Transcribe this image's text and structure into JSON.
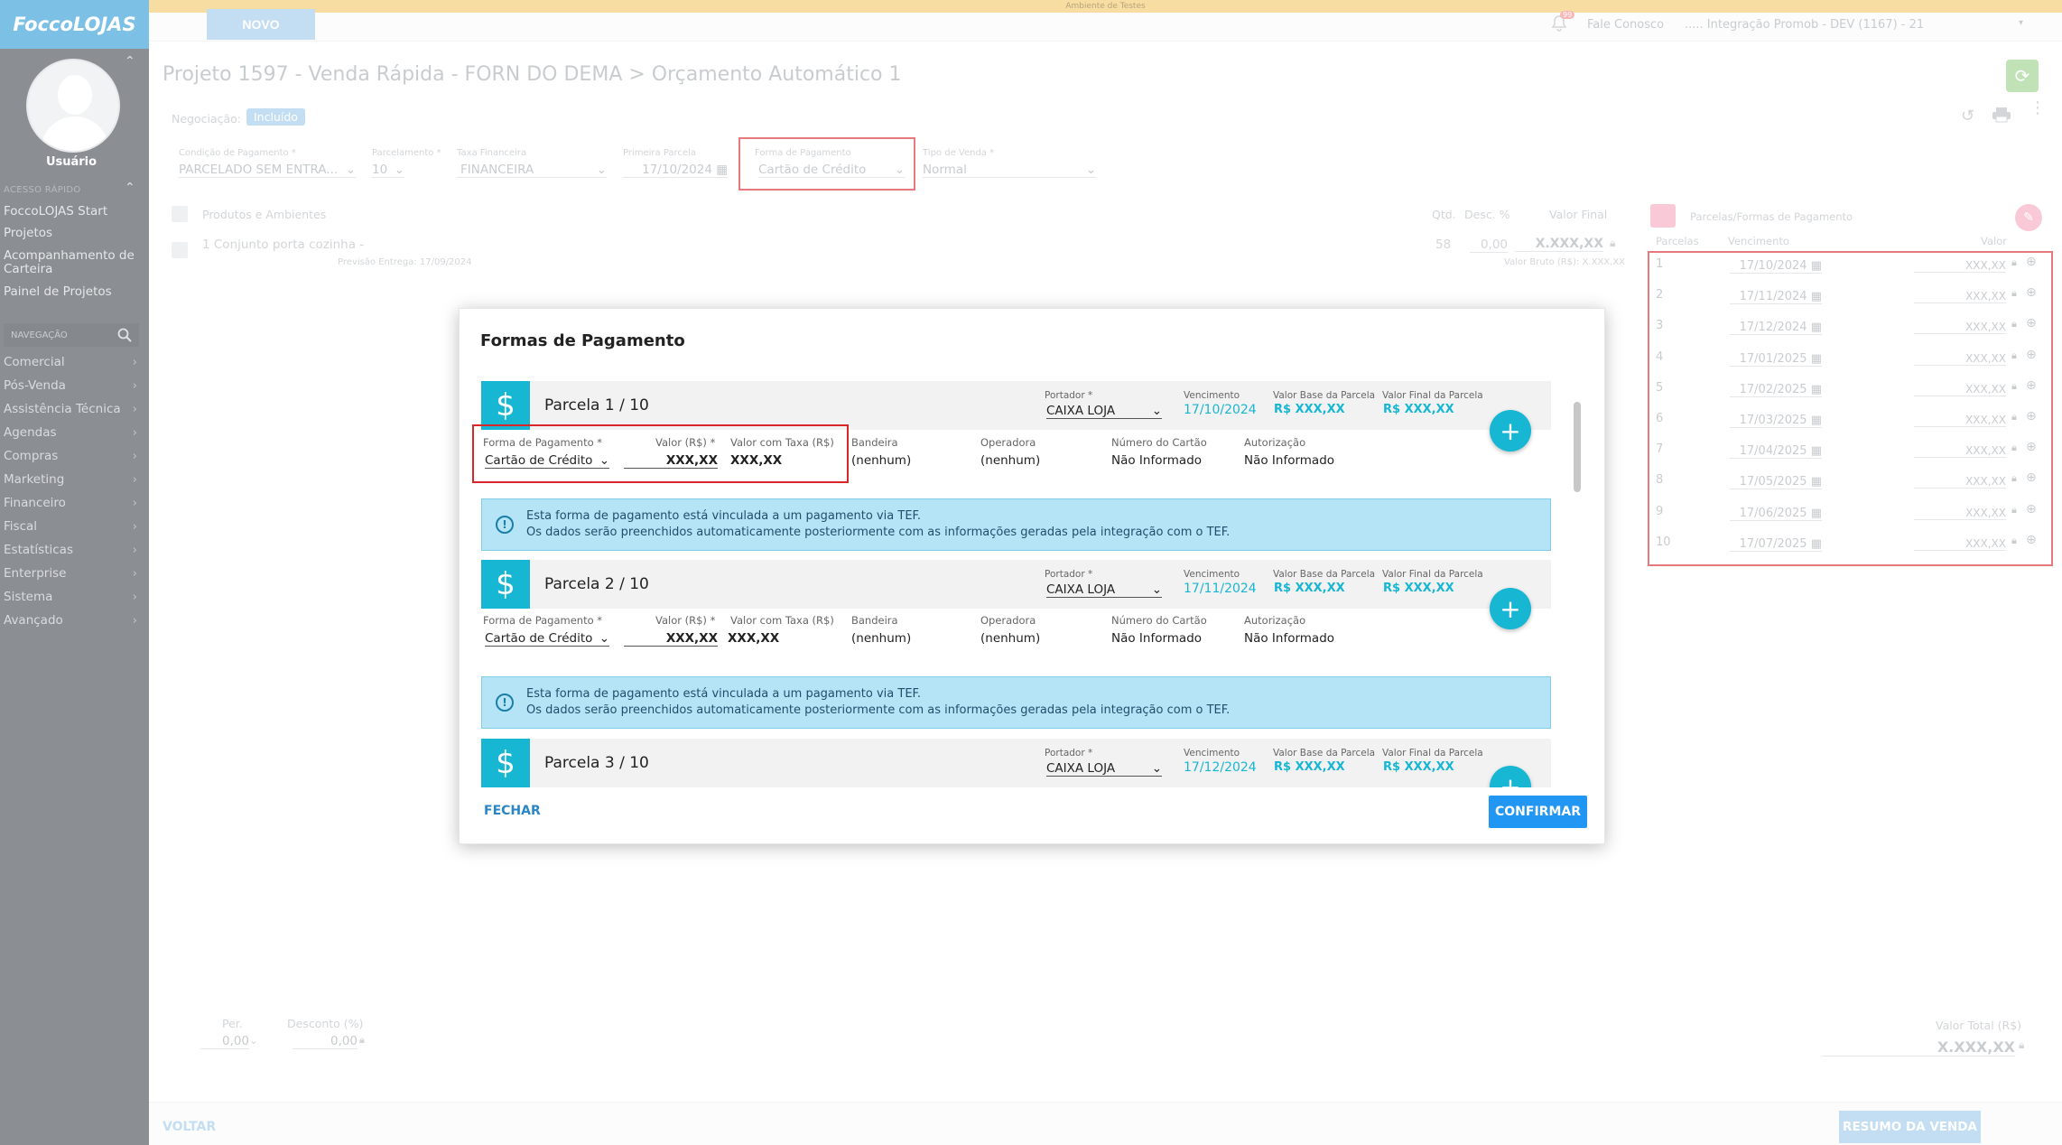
{
  "app": {
    "logo": "FoccoLOJAS",
    "environment": "Ambiente de Testes",
    "new_button": "NOVO"
  },
  "top_right": {
    "notification_count": "99",
    "contact": "Fale Conosco",
    "company": "..... Integração Promob - DEV (1167) - 21"
  },
  "sidebar": {
    "user": "Usuário",
    "quick_access_title": "ACESSO RÁPIDO",
    "quick_links": [
      "FoccoLOJAS Start",
      "Projetos",
      "Acompanhamento de Carteira",
      "Painel de Projetos"
    ],
    "nav_search_label": "NAVEGAÇÃO",
    "nav_items": [
      "Comercial",
      "Pós-Venda",
      "Assistência Técnica",
      "Agendas",
      "Compras",
      "Marketing",
      "Financeiro",
      "Fiscal",
      "Estatísticas",
      "Enterprise",
      "Sistema",
      "Avançado"
    ]
  },
  "page": {
    "title": "Projeto 1597 - Venda Rápida - FORN DO DEMA > Orçamento Automático 1",
    "negotiation_label": "Negociação:",
    "negotiation_status": "Incluído"
  },
  "form": {
    "cond_pag": {
      "label": "Condição de Pagamento *",
      "value": "PARCELADO SEM ENTRA..."
    },
    "parcelamento": {
      "label": "Parcelamento *",
      "value": "10"
    },
    "taxa": {
      "label": "Taxa Financeira",
      "value": "FINANCEIRA"
    },
    "primeira": {
      "label": "Primeira Parcela",
      "value": "17/10/2024"
    },
    "forma": {
      "label": "Forma de Pagamento",
      "value": "Cartão de Crédito"
    },
    "tipo": {
      "label": "Tipo de Venda *",
      "value": "Normal"
    }
  },
  "products": {
    "header": "Produtos e Ambientes",
    "col_qtd": "Qtd.",
    "col_desc": "Desc. %",
    "col_final": "Valor Final",
    "item_name": "1 Conjunto porta cozinha -",
    "item_delivery": "Previsão Entrega: 17/09/2024",
    "item_qty": "58",
    "item_desc": "0,00",
    "item_value": "X.XXX,XX",
    "item_gross": "Valor Bruto (R$): X.XXX,XX"
  },
  "parcelas_panel": {
    "title": "Parcelas/Formas de Pagamento",
    "col_parcelas": "Parcelas",
    "col_venc": "Vencimento",
    "col_valor": "Valor",
    "rows": [
      {
        "n": "1",
        "date": "17/10/2024",
        "value": "XXX,XX"
      },
      {
        "n": "2",
        "date": "17/11/2024",
        "value": "XXX,XX"
      },
      {
        "n": "3",
        "date": "17/12/2024",
        "value": "XXX,XX"
      },
      {
        "n": "4",
        "date": "17/01/2025",
        "value": "XXX,XX"
      },
      {
        "n": "5",
        "date": "17/02/2025",
        "value": "XXX,XX"
      },
      {
        "n": "6",
        "date": "17/03/2025",
        "value": "XXX,XX"
      },
      {
        "n": "7",
        "date": "17/04/2025",
        "value": "XXX,XX"
      },
      {
        "n": "8",
        "date": "17/05/2025",
        "value": "XXX,XX"
      },
      {
        "n": "9",
        "date": "17/06/2025",
        "value": "XXX,XX"
      },
      {
        "n": "10",
        "date": "17/07/2025",
        "value": "XXX,XX"
      }
    ]
  },
  "footer": {
    "per_label": "Per.",
    "per_value": "0,00",
    "desconto_label": "Desconto (%)",
    "desconto_value": "0,00",
    "total_label": "Valor Total (R$)",
    "total_value": "X.XXX,XX",
    "voltar": "VOLTAR",
    "resumo": "RESUMO DA VENDA"
  },
  "modal": {
    "title": "Formas de Pagamento",
    "close": "FECHAR",
    "confirm": "CONFIRMAR",
    "labels": {
      "portador": "Portador *",
      "vencimento": "Vencimento",
      "base": "Valor Base da Parcela",
      "final": "Valor Final da Parcela",
      "forma": "Forma de Pagamento *",
      "valor": "Valor (R$) *",
      "taxa": "Valor com Taxa (R$)",
      "bandeira": "Bandeira",
      "operadora": "Operadora",
      "cartao": "Número do Cartão",
      "autorizacao": "Autorização"
    },
    "info_line1": "Esta forma de pagamento está vinculada a um pagamento via TEF.",
    "info_line2": "Os dados serão preenchidos automaticamente posteriormente com as informações geradas pela integração com o TEF.",
    "parcelas": [
      {
        "title": "Parcela 1 / 10",
        "portador": "CAIXA LOJA",
        "vencimento": "17/10/2024",
        "base": "R$ XXX,XX",
        "final": "R$ XXX,XX",
        "forma": "Cartão de Crédito",
        "valor": "XXX,XX",
        "taxa": "XXX,XX",
        "bandeira": "(nenhum)",
        "operadora": "(nenhum)",
        "cartao": "Não Informado",
        "autorizacao": "Não Informado"
      },
      {
        "title": "Parcela 2 / 10",
        "portador": "CAIXA LOJA",
        "vencimento": "17/11/2024",
        "base": "R$ XXX,XX",
        "final": "R$ XXX,XX",
        "forma": "Cartão de Crédito",
        "valor": "XXX,XX",
        "taxa": "XXX,XX",
        "bandeira": "(nenhum)",
        "operadora": "(nenhum)",
        "cartao": "Não Informado",
        "autorizacao": "Não Informado"
      },
      {
        "title": "Parcela 3 / 10",
        "portador": "CAIXA LOJA",
        "vencimento": "17/12/2024",
        "base": "R$ XXX,XX",
        "final": "R$ XXX,XX"
      }
    ]
  }
}
